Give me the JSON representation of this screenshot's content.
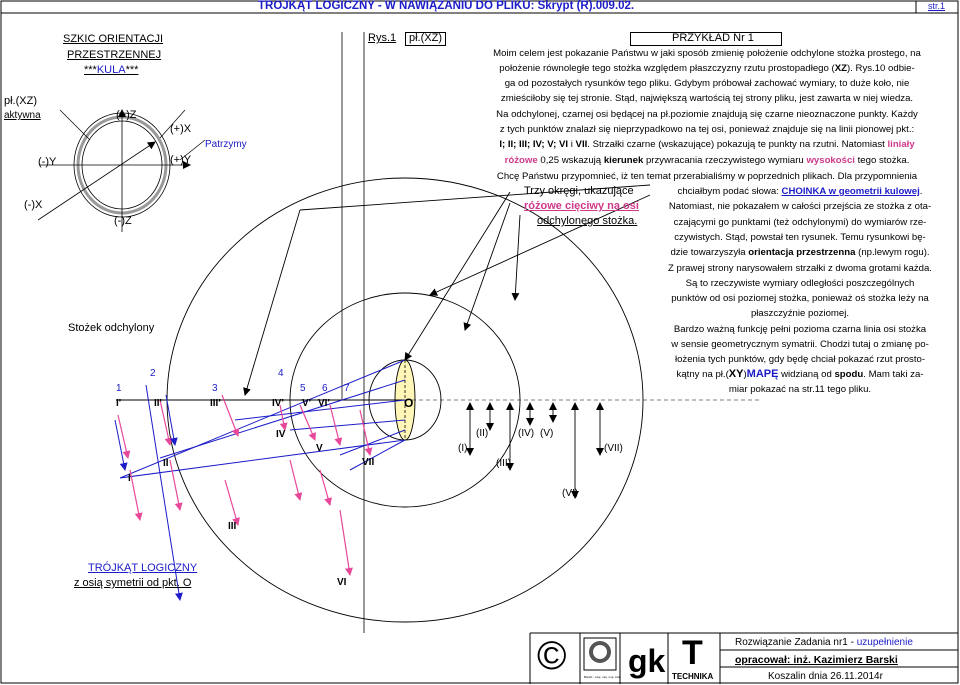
{
  "header": {
    "title": "TRÓJKĄT LOGICZNY - W NAWIĄZANIU DO PLIKU: Skrypt (R).009.02.",
    "page": "str.1",
    "rys": "Rys.1",
    "plane": "pł.(XZ)",
    "example": "PRZYKŁAD Nr 1"
  },
  "left": {
    "title1": "SZKIC ORIENTACJI",
    "title2": "PRZESTRZENNEJ",
    "title3_prefix": "***",
    "title3_kula": "KULA",
    "title3_suffix": "***",
    "plane": "pł.(XZ)",
    "active": "aktywna",
    "plusZ": "(+)Z",
    "plusX": "(+)X",
    "minusY": "(-)Y",
    "plusY": "(+)Y",
    "minusX": "(-)X",
    "minusZ": "(-)Z",
    "patrzymy": "Patrzymy",
    "cone": "Stożek odchylony",
    "triangle_title": "TRÓJKĄT LOGICZNY",
    "triangle_sub": "z osią symetrii od pkt. O"
  },
  "diagram": {
    "numbers": [
      "1",
      "2",
      "3",
      "4",
      "5",
      "6",
      "7"
    ],
    "primed": [
      "I'",
      "II'",
      "III'",
      "IV'",
      "V'",
      "VI'"
    ],
    "O": "O",
    "roman": [
      "I",
      "II",
      "III",
      "IV",
      "V",
      "VI",
      "VII"
    ],
    "paren": [
      "(I)",
      "(II)",
      "(III)",
      "(IV)",
      "(V)",
      "(VI)",
      "(VII)"
    ],
    "callout1": "Trzy okręgi, ukazujące",
    "callout2": "różowe cięciwy na osi",
    "callout3": "odchylonego stożka."
  },
  "text": {
    "l1": "Moim celem jest pokazanie Państwu w jaki sposób zmienię położenie odchylone stożka prostego, na",
    "l2a": "położenie równoległe tego stożka względem płaszczyzny rzutu prostopadłego (",
    "l2xz": "XZ",
    "l2b": "). Rys.10 odbie-",
    "l3": "ga od pozostałych rysunków tego pliku. Gdybym próbował zachować wymiary, to duże koło, nie",
    "l4": "zmieściłoby się tej stronie. Stąd, największą wartością tej strony pliku, jest zawarta w niej wiedza.",
    "l5": "Na odchylonej, czarnej osi będącej na pł.poziomie znajdują się czarne nieoznaczone punkty. Każdy",
    "l6": "z tych punktów znalazł się nieprzypadkowo na tej osi, ponieważ znajduje się na linii pionowej pkt.:",
    "l7_points": "I; II; III; IV; V; VI",
    "l7_and": " i ",
    "l7_vii": "VII",
    "l7_rest": ". Strzałki czarne (wskazujące) pokazują te punkty na rzutni. Natomiast ",
    "l7_liniały": "liniały",
    "l8_rozowe": "różowe",
    "l8_a": " 0,25 wskazują ",
    "l8_kierunek": "kierunek",
    "l8_b": " przywracania rzeczywistego wymiaru ",
    "l8_wysokosci": "wysokości",
    "l8_c": " tego stożka.",
    "l9": "Chcę Państwu przypomnieć, iż ten temat przerabialiśmy w poprzednich plikach. Dla przypomnienia",
    "r1a": "chciałbym podać słowa: ",
    "r1link": "CHOINKA w geometrii kulowej",
    "r1b": ".",
    "r2": "Natomiast, nie pokazałem w całości przejścia ze stożka z ota-",
    "r3": "czającymi go punktami (też odchylonymi) do wymiarów rze-",
    "r4": "czywistych. Stąd, powstał ten rysunek. Temu rysunkowi bę-",
    "r5a": "dzie towarzyszyła ",
    "r5b": "orientacja przestrzenna",
    "r5c": " (np.lewym rogu).",
    "r6": "Z prawej strony narysowałem strzałki z dwoma grotami każda.",
    "r7": "Są to rzeczywiste wymiary odległości poszczególnych",
    "r8": "punktów od osi poziomej stożka, ponieważ oś stożka leży na",
    "r9": "płaszczyźnie poziomej.",
    "r10": "Bardzo ważną funkcję pełni pozioma czarna linia osi stożka",
    "r11": "w sensie geometrycznym symatrii. Chodzi tutaj o zmianę po-",
    "r12": "łożenia tych punktów, gdy będę chciał pokazać rzut prosto-",
    "r13a": "kątny na pł.(",
    "r13xy": "XY",
    "r13b": ")",
    "r13mape": "MAPĘ",
    "r13c": " widzianą od ",
    "r13spodu": "spodu",
    "r13d": ". Mam taki za-",
    "r14": "miar pokazać na str.11 tego pliku."
  },
  "footer": {
    "copyright": "©",
    "gk": "gk",
    "T": "T",
    "technika": "TECHNIKA",
    "solution_a": "Rozwiązanie Zadania nr1 - ",
    "solution_b": "uzupełnienie",
    "author_a": "opracował: ",
    "author_b": "inż. Kazimierz Barski",
    "date": "Koszalin dnia 26.11.2014r",
    "logo_text": "gk",
    "small": "Barski - szej. moj. moj. szat"
  },
  "colors": {
    "blue": "#1c1cc8",
    "pink": "#d03a8a",
    "arrow_pink": "#e8489a",
    "cone_fill": "#fff6b8"
  }
}
